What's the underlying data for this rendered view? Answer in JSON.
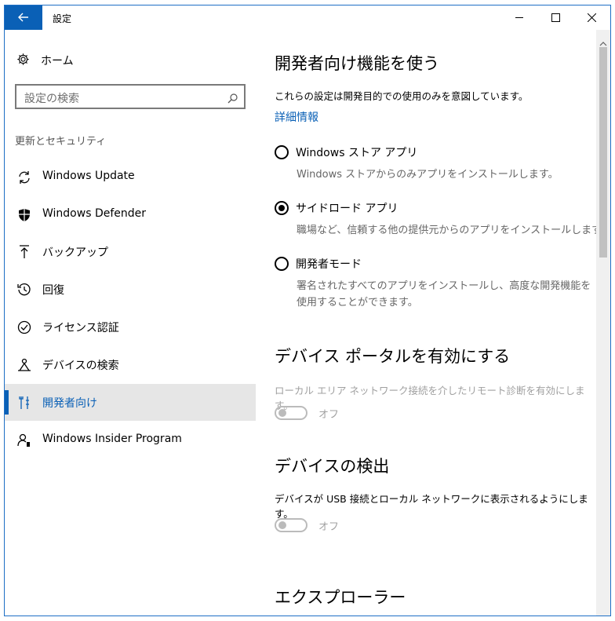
{
  "window": {
    "title": "設定"
  },
  "sidebar": {
    "home_label": "ホーム",
    "search_placeholder": "設定の検索",
    "section_label": "更新とセキュリティ",
    "items": [
      {
        "label": "Windows Update",
        "icon": "sync-icon"
      },
      {
        "label": "Windows Defender",
        "icon": "shield-icon"
      },
      {
        "label": "バックアップ",
        "icon": "upload-arrow-icon"
      },
      {
        "label": "回復",
        "icon": "history-icon"
      },
      {
        "label": "ライセンス認証",
        "icon": "check-circle-icon"
      },
      {
        "label": "デバイスの検索",
        "icon": "person-pin-icon"
      },
      {
        "label": "開発者向け",
        "icon": "developer-tools-icon",
        "selected": true
      },
      {
        "label": "Windows Insider Program",
        "icon": "insider-person-icon"
      }
    ]
  },
  "main": {
    "dev_title": "開発者向け機能を使う",
    "dev_desc": "これらの設定は開発目的での使用のみを意図しています。",
    "more_info_link": "詳細情報",
    "options": [
      {
        "label": "Windows ストア アプリ",
        "desc": "Windows ストアからのみアプリをインストールします。",
        "checked": false
      },
      {
        "label": "サイドロード アプリ",
        "desc": "職場など、信頼する他の提供元からのアプリをインストールします。",
        "checked": true
      },
      {
        "label": "開発者モード",
        "desc": "署名されたすべてのアプリをインストールし、高度な開発機能を使用することができます。",
        "checked": false
      }
    ],
    "portal": {
      "title": "デバイス ポータルを有効にする",
      "desc": "ローカル エリア ネットワーク接続を介したリモート診断を有効にします。",
      "toggle_label": "オフ",
      "toggle_on": false
    },
    "discovery": {
      "title": "デバイスの検出",
      "desc": "デバイスが USB 接続とローカル ネットワークに表示されるようにします。",
      "toggle_label": "オフ",
      "toggle_on": false
    },
    "explorer_title": "エクスプローラー"
  },
  "colors": {
    "accent": "#0a60b6",
    "selected_bg": "#e6e6e6"
  }
}
